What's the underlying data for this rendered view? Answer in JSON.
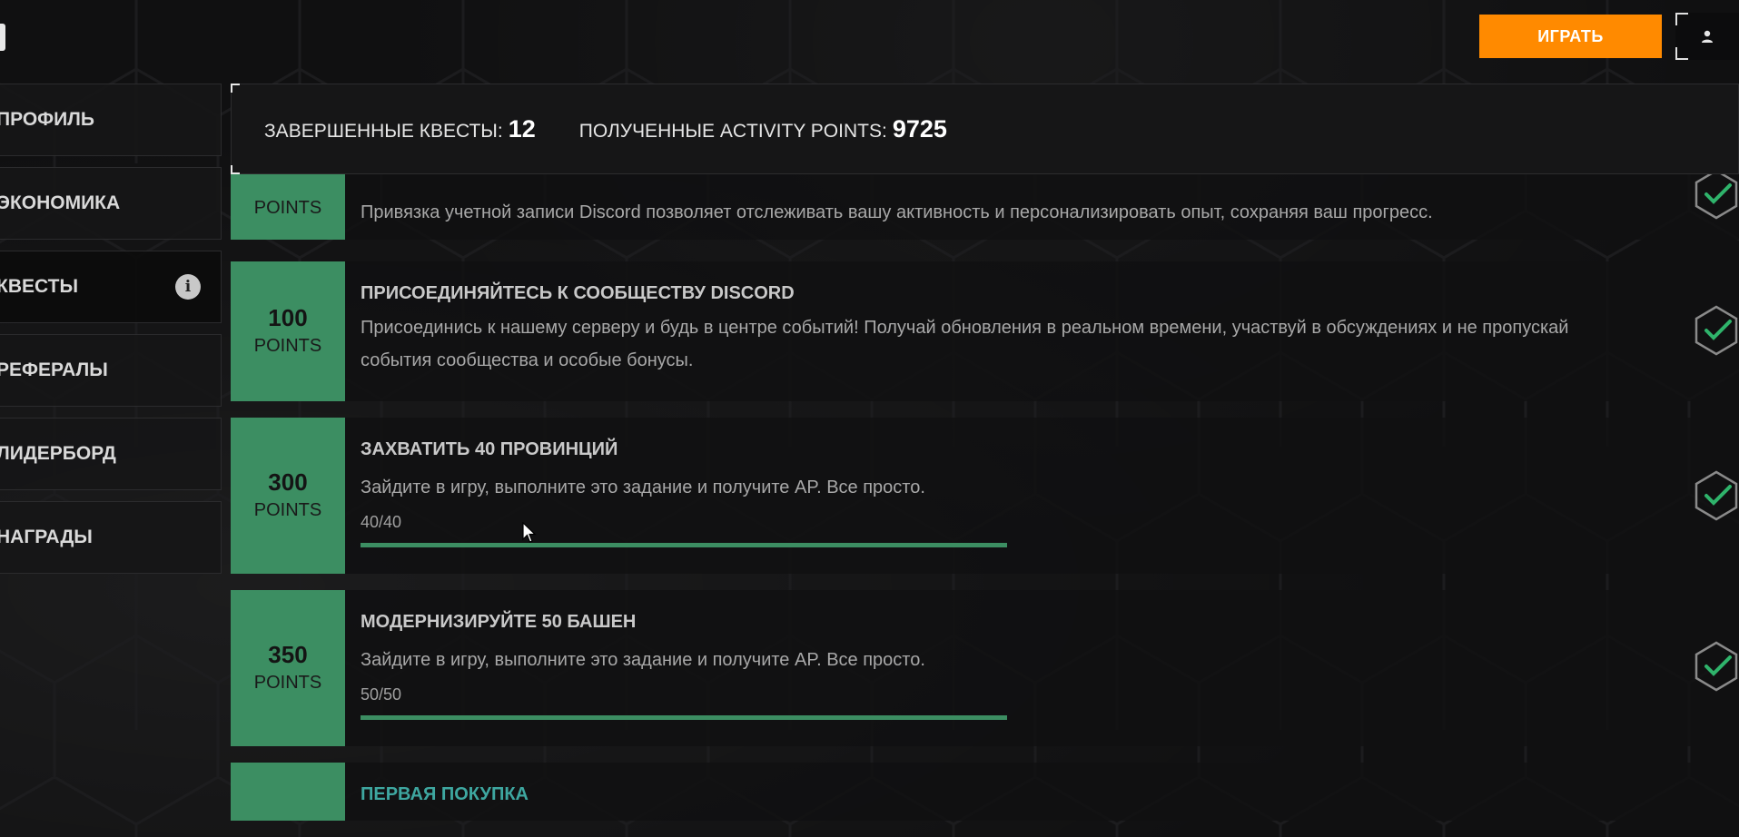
{
  "header": {
    "play_label": "ИГРАТЬ"
  },
  "sidebar": {
    "items": [
      {
        "label": "ПРОФИЛЬ",
        "active": false
      },
      {
        "label": "ЭКОНОМИКА",
        "active": false
      },
      {
        "label": "КВЕСТЫ",
        "active": true,
        "info": "i"
      },
      {
        "label": "РЕФЕРАЛЫ",
        "active": false
      },
      {
        "label": "ЛИДЕРБОРД",
        "active": false
      },
      {
        "label": "НАГРАДЫ",
        "active": false
      }
    ]
  },
  "stats": {
    "completed_label": "ЗАВЕРШЕННЫЕ КВЕСТЫ:",
    "completed_value": "12",
    "points_label": "ПОЛУЧЕННЫЕ ACTIVITY POINTS:",
    "points_value": "9725"
  },
  "quests": [
    {
      "points": "",
      "points_unit": "POINTS",
      "title": "",
      "description": "Привязка учетной записи Discord позволяет отслеживать вашу активность и персонализировать опыт, сохраняя ваш прогресс.",
      "completed": true
    },
    {
      "points": "100",
      "points_unit": "POINTS",
      "title": "ПРИСОЕДИНЯЙТЕСЬ К СООБЩЕСТВУ DISCORD",
      "description": "Присоединись к нашему серверу и будь в центре событий! Получай обновления в реальном времени, участвуй в обсуждениях и не пропускай события сообщества и особые бонусы.",
      "completed": true
    },
    {
      "points": "300",
      "points_unit": "POINTS",
      "title": "ЗАХВАТИТЬ 40 ПРОВИНЦИЙ",
      "description": "Зайдите в игру, выполните это задание и получите AP. Все просто.",
      "progress_text": "40/40",
      "progress_fraction": 1.0,
      "completed": true
    },
    {
      "points": "350",
      "points_unit": "POINTS",
      "title": "МОДЕРНИЗИРУЙТЕ 50 БАШЕН",
      "description": "Зайдите в игру, выполните это задание и получите AP. Все просто.",
      "progress_text": "50/50",
      "progress_fraction": 1.0,
      "completed": true
    },
    {
      "points": "",
      "points_unit": "",
      "title": "ПЕРВАЯ ПОКУПКА",
      "description": "",
      "completed": false
    }
  ],
  "colors": {
    "accent_orange": "#ff8a00",
    "points_green": "#3c8e62",
    "check_green": "#2fb36b",
    "teal_title": "#3ea7a0"
  },
  "icons": {
    "profile": "user-icon",
    "check": "check-hexagon-icon",
    "info": "info-icon"
  }
}
